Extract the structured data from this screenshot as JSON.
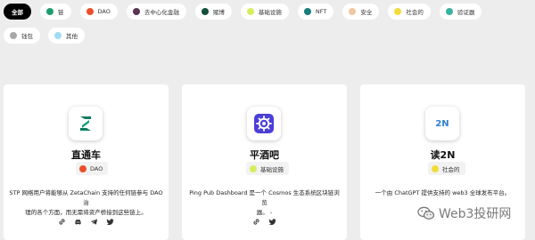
{
  "filters": {
    "row1": [
      {
        "label": "全部",
        "active": true
      },
      {
        "label": "链",
        "color": "#1e9e6e"
      },
      {
        "label": "DAO",
        "color": "#ea4f2c"
      },
      {
        "label": "去中心化金融",
        "color": "#5a3550"
      },
      {
        "label": "赌博",
        "color": "#14503c"
      },
      {
        "label": "基础设施",
        "color": "#d4ee5e"
      },
      {
        "label": "NFT",
        "color": "#177c7c"
      },
      {
        "label": "安全",
        "color": "#f2c6a0"
      },
      {
        "label": "社会的",
        "color": "#f2dc3c"
      },
      {
        "label": "验证器",
        "color": "#3ab2a2"
      }
    ],
    "row2": [
      {
        "label": "钱包",
        "color": "#a8a8a8"
      },
      {
        "label": "其他",
        "color": "#a0dcf4"
      }
    ]
  },
  "cards": [
    {
      "title": "直通车",
      "logo": "zetachain-arrow-logo",
      "tag": {
        "label": "DAO",
        "color": "#ea4f2c"
      },
      "description_lines": [
        "STP 网络用户将能够从 ZetaChain 支持的任何链参与 DAO 治",
        "理的各个方面，而无需将资产桥接到这些链上。"
      ],
      "socials": [
        "link-icon",
        "discord-icon",
        "telegram-icon",
        "twitter-icon"
      ]
    },
    {
      "title": "平酒吧",
      "logo": "ping-pub-gear-logo",
      "tag": {
        "label": "基础设施",
        "color": "#d4ee5e"
      },
      "description_lines": [
        "Ping Pub Dashboard 是一个 Cosmos 生态系统区块链浏览",
        "器。 -"
      ],
      "socials": [
        "link-icon",
        "twitter-icon"
      ]
    },
    {
      "title": "读2N",
      "logo": "read2n-logo",
      "logo_text": "2N",
      "tag": {
        "label": "社会的",
        "color": "#f2dc3c"
      },
      "description_lines": [
        "一个由 ChatGPT 提供支持的 web3 全球发布平台。"
      ],
      "socials": [
        "link-icon",
        "twitter-icon"
      ]
    }
  ],
  "watermark": {
    "text": "Web3投研网"
  }
}
